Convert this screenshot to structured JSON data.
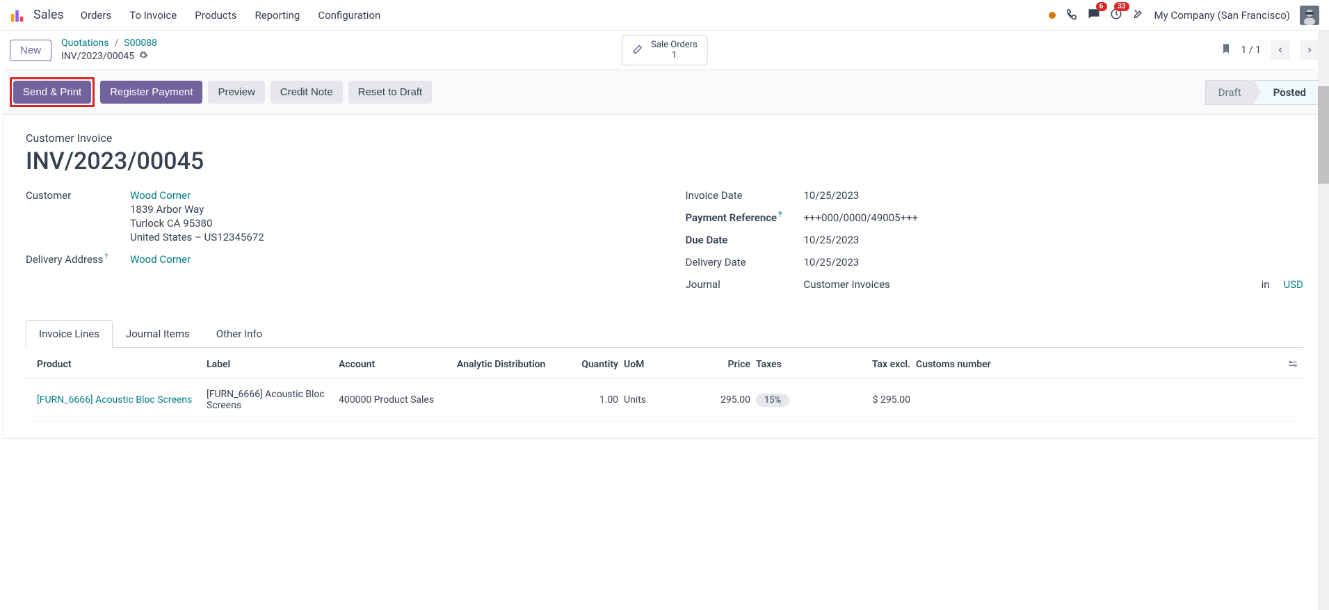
{
  "nav": {
    "app": "Sales",
    "items": [
      "Orders",
      "To Invoice",
      "Products",
      "Reporting",
      "Configuration"
    ],
    "company": "My Company (San Francisco)",
    "chat_badge": "6",
    "activity_badge": "33"
  },
  "header": {
    "new": "New",
    "crumb_quotations": "Quotations",
    "crumb_order": "S00088",
    "crumb_invoice": "INV/2023/00045",
    "sale_orders_label": "Sale Orders",
    "sale_orders_count": "1",
    "pager": "1 / 1"
  },
  "actions": {
    "send_print": "Send & Print",
    "register_payment": "Register Payment",
    "preview": "Preview",
    "credit_note": "Credit Note",
    "reset_draft": "Reset to Draft",
    "status_draft": "Draft",
    "status_posted": "Posted"
  },
  "doc": {
    "type": "Customer Invoice",
    "title": "INV/2023/00045",
    "labels": {
      "customer": "Customer",
      "delivery_addr": "Delivery Address",
      "invoice_date": "Invoice Date",
      "payment_ref": "Payment Reference",
      "due_date": "Due Date",
      "delivery_date": "Delivery Date",
      "journal": "Journal",
      "in": "in"
    },
    "customer_name": "Wood Corner",
    "addr1": "1839 Arbor Way",
    "addr2": "Turlock CA 95380",
    "addr3": "United States – US12345672",
    "delivery_addr": "Wood Corner",
    "invoice_date": "10/25/2023",
    "payment_ref": "+++000/0000/49005+++",
    "due_date": "10/25/2023",
    "delivery_date": "10/25/2023",
    "journal": "Customer Invoices",
    "currency": "USD"
  },
  "tabs": {
    "invoice_lines": "Invoice Lines",
    "journal_items": "Journal Items",
    "other_info": "Other Info"
  },
  "table": {
    "headers": {
      "product": "Product",
      "label": "Label",
      "account": "Account",
      "analytic": "Analytic Distribution",
      "qty": "Quantity",
      "uom": "UoM",
      "price": "Price",
      "taxes": "Taxes",
      "tax_excl": "Tax excl.",
      "customs": "Customs number"
    },
    "row": {
      "product": "[FURN_6666] Acoustic Bloc Screens",
      "label": "[FURN_6666] Acoustic Bloc Screens",
      "account": "400000 Product Sales",
      "analytic": "",
      "qty": "1.00",
      "uom": "Units",
      "price": "295.00",
      "taxes": "15%",
      "tax_excl": "$ 295.00",
      "customs": ""
    }
  }
}
